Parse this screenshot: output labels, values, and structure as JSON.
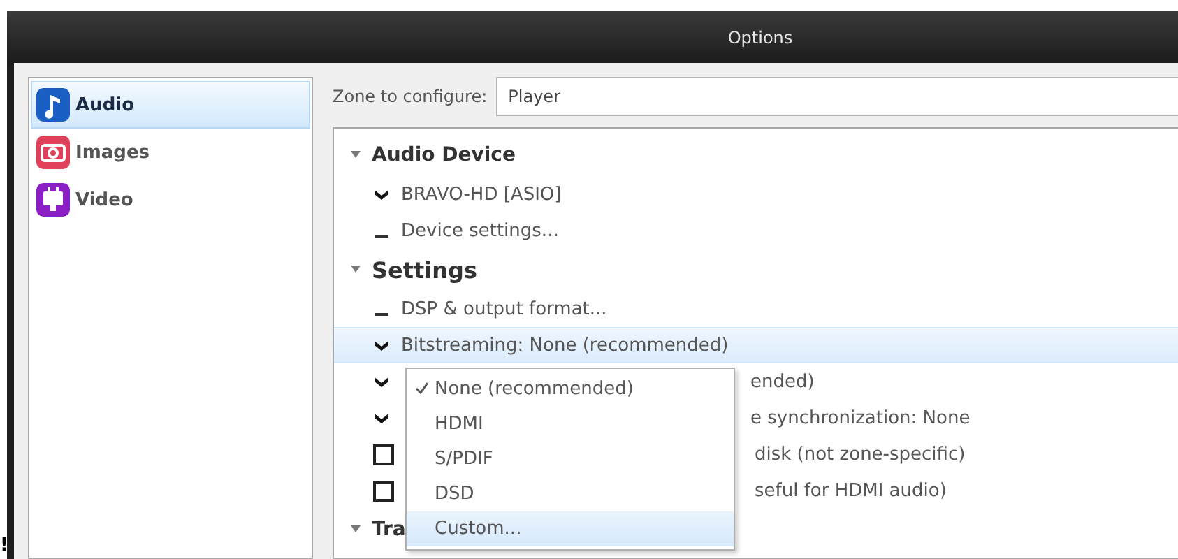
{
  "window": {
    "title": "Options"
  },
  "sidebar": {
    "items": [
      {
        "label": "Audio",
        "selected": true
      },
      {
        "label": "Images",
        "selected": false
      },
      {
        "label": "Video",
        "selected": false
      }
    ]
  },
  "zone": {
    "label": "Zone to configure:",
    "value": "Player"
  },
  "tree": [
    {
      "label": "Audio Device",
      "expanded": true,
      "children": [
        {
          "kind": "dropdown",
          "label": "BRAVO-HD [ASIO]",
          "selected": false
        },
        {
          "kind": "action",
          "label": "Device settings...",
          "selected": false
        }
      ]
    },
    {
      "label": "Settings",
      "expanded": true,
      "children": [
        {
          "kind": "action",
          "label": "DSP & output format...",
          "selected": false
        },
        {
          "kind": "dropdown",
          "label": "Bitstreaming: None (recommended)",
          "selected": true
        },
        {
          "kind": "dropdown",
          "label": "ended)",
          "covered": true,
          "selected": false
        },
        {
          "kind": "dropdown",
          "label": "e synchronization: None",
          "covered": true,
          "selected": false
        },
        {
          "kind": "checkbox",
          "label": "disk (not zone-specific)",
          "covered": true,
          "checked": false,
          "selected": false
        },
        {
          "kind": "checkbox",
          "label": "seful for HDMI audio)",
          "covered": true,
          "checked": false,
          "selected": false
        }
      ]
    },
    {
      "label": "Tra",
      "expanded": true
    }
  ],
  "menu": {
    "items": [
      {
        "label": "None (recommended)",
        "selected": true,
        "hovered": false
      },
      {
        "label": "HDMI",
        "selected": false,
        "hovered": false
      },
      {
        "label": "S/PDIF",
        "selected": false,
        "hovered": false
      },
      {
        "label": "DSD",
        "selected": false,
        "hovered": false
      },
      {
        "label": "Custom...",
        "selected": false,
        "hovered": true
      }
    ]
  },
  "corner_mark": "!"
}
